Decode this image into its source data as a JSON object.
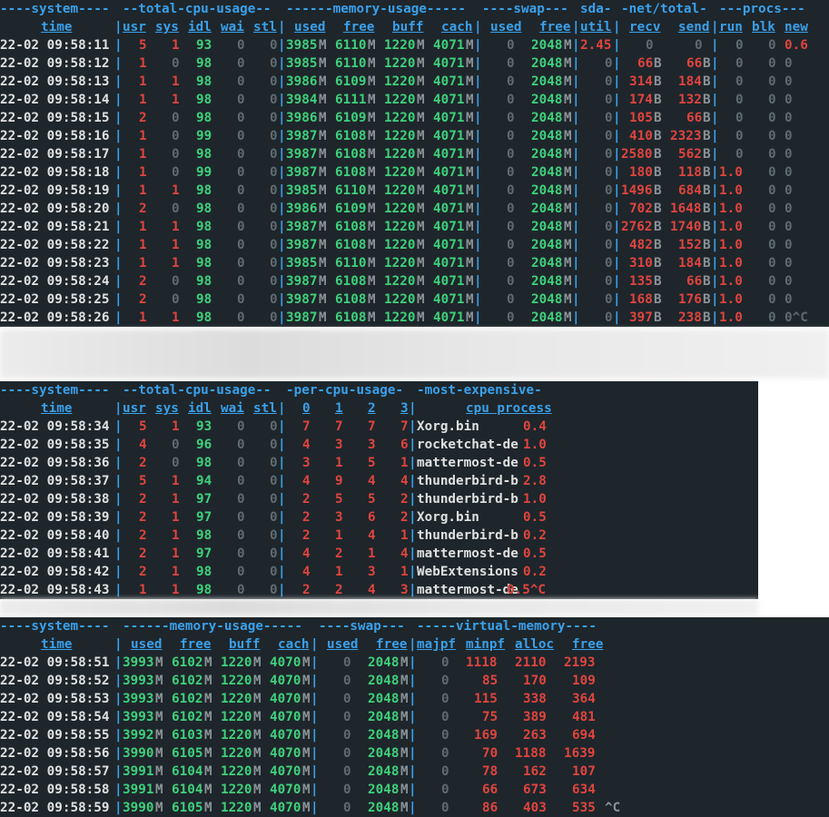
{
  "t1": {
    "groups": [
      "----system----",
      "--total-cpu-usage--",
      "------memory-usage-----",
      "----swap---",
      "sda-",
      "-net/total-",
      "---procs---"
    ],
    "headers": [
      "time",
      "usr",
      "sys",
      "idl",
      "wai",
      "stl",
      "used",
      "free",
      "buff",
      "cach",
      "used",
      "free",
      "util",
      "recv",
      "send",
      "run",
      "blk",
      "new"
    ],
    "rows": [
      [
        "22-02 09:58:11",
        "5",
        "1",
        "93",
        "0",
        "0",
        "3985",
        "M",
        "6110",
        "M",
        "1220",
        "M",
        "4071",
        "M",
        "0",
        "",
        "2048",
        "M",
        "2.45",
        "0",
        "",
        "0",
        "",
        "0",
        "0",
        "0.6"
      ],
      [
        "22-02 09:58:12",
        "1",
        "0",
        "98",
        "0",
        "0",
        "3985",
        "M",
        "6110",
        "M",
        "1220",
        "M",
        "4071",
        "M",
        "0",
        "",
        "2048",
        "M",
        "0",
        "66",
        "B",
        "66",
        "B",
        "0",
        "0",
        "0"
      ],
      [
        "22-02 09:58:13",
        "1",
        "1",
        "98",
        "0",
        "0",
        "3986",
        "M",
        "6109",
        "M",
        "1220",
        "M",
        "4071",
        "M",
        "0",
        "",
        "2048",
        "M",
        "0",
        "314",
        "B",
        "184",
        "B",
        "0",
        "0",
        "0"
      ],
      [
        "22-02 09:58:14",
        "1",
        "1",
        "98",
        "0",
        "0",
        "3984",
        "M",
        "6111",
        "M",
        "1220",
        "M",
        "4071",
        "M",
        "0",
        "",
        "2048",
        "M",
        "0",
        "174",
        "B",
        "132",
        "B",
        "0",
        "0",
        "0"
      ],
      [
        "22-02 09:58:15",
        "2",
        "0",
        "98",
        "0",
        "0",
        "3986",
        "M",
        "6109",
        "M",
        "1220",
        "M",
        "4071",
        "M",
        "0",
        "",
        "2048",
        "M",
        "0",
        "105",
        "B",
        "66",
        "B",
        "0",
        "0",
        "0"
      ],
      [
        "22-02 09:58:16",
        "1",
        "0",
        "99",
        "0",
        "0",
        "3987",
        "M",
        "6108",
        "M",
        "1220",
        "M",
        "4071",
        "M",
        "0",
        "",
        "2048",
        "M",
        "0",
        "410",
        "B",
        "2323",
        "B",
        "0",
        "0",
        "0"
      ],
      [
        "22-02 09:58:17",
        "1",
        "0",
        "98",
        "0",
        "0",
        "3987",
        "M",
        "6108",
        "M",
        "1220",
        "M",
        "4071",
        "M",
        "0",
        "",
        "2048",
        "M",
        "0",
        "2580",
        "B",
        "562",
        "B",
        "0",
        "0",
        "0"
      ],
      [
        "22-02 09:58:18",
        "1",
        "0",
        "99",
        "0",
        "0",
        "3987",
        "M",
        "6108",
        "M",
        "1220",
        "M",
        "4071",
        "M",
        "0",
        "",
        "2048",
        "M",
        "0",
        "180",
        "B",
        "118",
        "B",
        "1.0",
        "0",
        "0"
      ],
      [
        "22-02 09:58:19",
        "1",
        "1",
        "98",
        "0",
        "0",
        "3985",
        "M",
        "6110",
        "M",
        "1220",
        "M",
        "4071",
        "M",
        "0",
        "",
        "2048",
        "M",
        "0",
        "1496",
        "B",
        "684",
        "B",
        "1.0",
        "0",
        "0"
      ],
      [
        "22-02 09:58:20",
        "2",
        "0",
        "98",
        "0",
        "0",
        "3986",
        "M",
        "6109",
        "M",
        "1220",
        "M",
        "4071",
        "M",
        "0",
        "",
        "2048",
        "M",
        "0",
        "702",
        "B",
        "1648",
        "B",
        "1.0",
        "0",
        "0"
      ],
      [
        "22-02 09:58:21",
        "1",
        "1",
        "98",
        "0",
        "0",
        "3987",
        "M",
        "6108",
        "M",
        "1220",
        "M",
        "4071",
        "M",
        "0",
        "",
        "2048",
        "M",
        "0",
        "2762",
        "B",
        "1740",
        "B",
        "1.0",
        "0",
        "0"
      ],
      [
        "22-02 09:58:22",
        "1",
        "1",
        "98",
        "0",
        "0",
        "3987",
        "M",
        "6108",
        "M",
        "1220",
        "M",
        "4071",
        "M",
        "0",
        "",
        "2048",
        "M",
        "0",
        "482",
        "B",
        "152",
        "B",
        "1.0",
        "0",
        "0"
      ],
      [
        "22-02 09:58:23",
        "1",
        "1",
        "98",
        "0",
        "0",
        "3985",
        "M",
        "6110",
        "M",
        "1220",
        "M",
        "4071",
        "M",
        "0",
        "",
        "2048",
        "M",
        "0",
        "310",
        "B",
        "184",
        "B",
        "1.0",
        "0",
        "0"
      ],
      [
        "22-02 09:58:24",
        "2",
        "0",
        "98",
        "0",
        "0",
        "3987",
        "M",
        "6108",
        "M",
        "1220",
        "M",
        "4071",
        "M",
        "0",
        "",
        "2048",
        "M",
        "0",
        "135",
        "B",
        "66",
        "B",
        "1.0",
        "0",
        "0"
      ],
      [
        "22-02 09:58:25",
        "2",
        "0",
        "98",
        "0",
        "0",
        "3987",
        "M",
        "6108",
        "M",
        "1220",
        "M",
        "4071",
        "M",
        "0",
        "",
        "2048",
        "M",
        "0",
        "168",
        "B",
        "176",
        "B",
        "1.0",
        "0",
        "0"
      ],
      [
        "22-02 09:58:26",
        "1",
        "1",
        "98",
        "0",
        "0",
        "3987",
        "M",
        "6108",
        "M",
        "1220",
        "M",
        "4071",
        "M",
        "0",
        "",
        "2048",
        "M",
        "0",
        "397",
        "B",
        "238",
        "B",
        "1.0",
        "0",
        "0^C"
      ]
    ]
  },
  "t2": {
    "groups": [
      "----system----",
      "--total-cpu-usage--",
      "-per-cpu-usage-",
      "-most-expensive-"
    ],
    "headers": [
      "time",
      "usr",
      "sys",
      "idl",
      "wai",
      "stl",
      "0",
      "1",
      "2",
      "3",
      "cpu process"
    ],
    "rows": [
      [
        "22-02 09:58:34",
        "5",
        "1",
        "93",
        "0",
        "0",
        "7",
        "7",
        "7",
        "7",
        "Xorg.bin",
        "0.4"
      ],
      [
        "22-02 09:58:35",
        "4",
        "0",
        "96",
        "0",
        "0",
        "4",
        "3",
        "3",
        "6",
        "rocketchat-de",
        "1.0"
      ],
      [
        "22-02 09:58:36",
        "2",
        "0",
        "98",
        "0",
        "0",
        "3",
        "1",
        "5",
        "1",
        "mattermost-de",
        "0.5"
      ],
      [
        "22-02 09:58:37",
        "5",
        "1",
        "94",
        "0",
        "0",
        "4",
        "9",
        "4",
        "4",
        "thunderbird-b",
        "2.8"
      ],
      [
        "22-02 09:58:38",
        "2",
        "1",
        "97",
        "0",
        "0",
        "2",
        "5",
        "5",
        "2",
        "thunderbird-b",
        "1.0"
      ],
      [
        "22-02 09:58:39",
        "2",
        "1",
        "97",
        "0",
        "0",
        "2",
        "3",
        "6",
        "2",
        "Xorg.bin",
        "0.5"
      ],
      [
        "22-02 09:58:40",
        "2",
        "1",
        "98",
        "0",
        "0",
        "2",
        "1",
        "4",
        "1",
        "thunderbird-b",
        "0.2"
      ],
      [
        "22-02 09:58:41",
        "2",
        "1",
        "97",
        "0",
        "0",
        "4",
        "2",
        "1",
        "4",
        "mattermost-de",
        "0.5"
      ],
      [
        "22-02 09:58:42",
        "2",
        "1",
        "98",
        "0",
        "0",
        "4",
        "1",
        "3",
        "1",
        "WebExtensions",
        "0.2"
      ],
      [
        "22-02 09:58:43",
        "1",
        "1",
        "98",
        "0",
        "0",
        "2",
        "2",
        "4",
        "3",
        "mattermost-de",
        "0.5^C"
      ]
    ]
  },
  "t3": {
    "groups": [
      "----system----",
      "------memory-usage-----",
      "----swap---",
      "-----virtual-memory----"
    ],
    "headers": [
      "time",
      "used",
      "free",
      "buff",
      "cach",
      "used",
      "free",
      "majpf",
      "minpf",
      "alloc",
      "free"
    ],
    "rows": [
      [
        "22-02 09:58:51",
        "3993",
        "M",
        "6102",
        "M",
        "1220",
        "M",
        "4070",
        "M",
        "0",
        "",
        "2048",
        "M",
        "0",
        "1118",
        "2110",
        "2193",
        ""
      ],
      [
        "22-02 09:58:52",
        "3993",
        "M",
        "6102",
        "M",
        "1220",
        "M",
        "4070",
        "M",
        "0",
        "",
        "2048",
        "M",
        "0",
        "85",
        "170",
        "109",
        ""
      ],
      [
        "22-02 09:58:53",
        "3993",
        "M",
        "6102",
        "M",
        "1220",
        "M",
        "4070",
        "M",
        "0",
        "",
        "2048",
        "M",
        "0",
        "115",
        "338",
        "364",
        ""
      ],
      [
        "22-02 09:58:54",
        "3993",
        "M",
        "6102",
        "M",
        "1220",
        "M",
        "4070",
        "M",
        "0",
        "",
        "2048",
        "M",
        "0",
        "75",
        "389",
        "481",
        ""
      ],
      [
        "22-02 09:58:55",
        "3992",
        "M",
        "6103",
        "M",
        "1220",
        "M",
        "4070",
        "M",
        "0",
        "",
        "2048",
        "M",
        "0",
        "169",
        "263",
        "694",
        ""
      ],
      [
        "22-02 09:58:56",
        "3990",
        "M",
        "6105",
        "M",
        "1220",
        "M",
        "4070",
        "M",
        "0",
        "",
        "2048",
        "M",
        "0",
        "70",
        "1188",
        "1639",
        ""
      ],
      [
        "22-02 09:58:57",
        "3991",
        "M",
        "6104",
        "M",
        "1220",
        "M",
        "4070",
        "M",
        "0",
        "",
        "2048",
        "M",
        "0",
        "78",
        "162",
        "107",
        ""
      ],
      [
        "22-02 09:58:58",
        "3991",
        "M",
        "6104",
        "M",
        "1220",
        "M",
        "4070",
        "M",
        "0",
        "",
        "2048",
        "M",
        "0",
        "66",
        "673",
        "634",
        ""
      ],
      [
        "22-02 09:58:59",
        "3990",
        "M",
        "6105",
        "M",
        "1220",
        "M",
        "4070",
        "M",
        "0",
        "",
        "2048",
        "M",
        "0",
        "86",
        "403",
        "535",
        "^C"
      ]
    ]
  },
  "colors": {
    "background": "#1e262b",
    "header": "#3aa0ea",
    "green": "#3fd07c",
    "red": "#e0443e",
    "text": "#e0e0e0",
    "dim": "#5f6a70"
  }
}
